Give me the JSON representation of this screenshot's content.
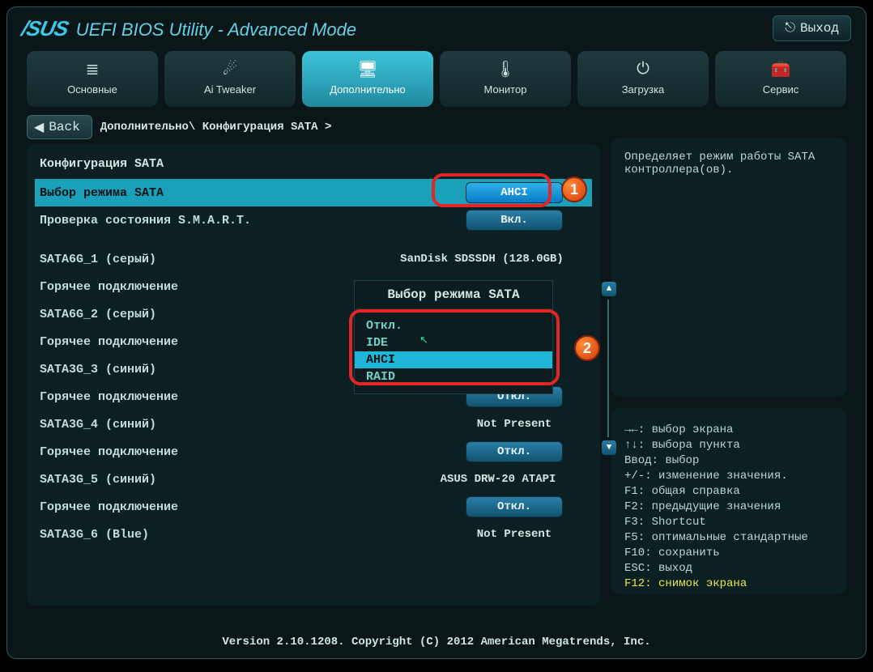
{
  "header": {
    "brand": "/SUS",
    "title": "UEFI BIOS Utility - Advanced Mode",
    "exit_label": "Выход"
  },
  "tabs": [
    {
      "label": "Основные"
    },
    {
      "label": "Ai Tweaker"
    },
    {
      "label": "Дополнительно"
    },
    {
      "label": "Монитор"
    },
    {
      "label": "Загрузка"
    },
    {
      "label": "Сервис"
    }
  ],
  "back_label": "Back",
  "breadcrumb": "Дополнительно\\ Конфигурация SATA >",
  "section_title": "Конфигурация SATA",
  "rows": {
    "sata_mode": {
      "label": "Выбор режима SATA",
      "value": "AHCI"
    },
    "smart": {
      "label": "Проверка состояния S.M.A.R.T.",
      "value": "Вкл."
    },
    "sata6g1": {
      "label": "SATA6G_1 (серый)",
      "value": "SanDisk SDSSDH (128.0GB)"
    },
    "hp1": {
      "label": "Горячее подключение",
      "value": ""
    },
    "sata6g2": {
      "label": "SATA6G_2 (серый)",
      "value": ""
    },
    "hp2": {
      "label": "Горячее подключение",
      "value": ""
    },
    "sata3g3": {
      "label": "SATA3G_3 (синий)",
      "value": ""
    },
    "hp3": {
      "label": "Горячее подключение",
      "value": "Откл."
    },
    "sata3g4": {
      "label": "SATA3G_4 (синий)",
      "value": "Not Present"
    },
    "hp4": {
      "label": "Горячее подключение",
      "value": "Откл."
    },
    "sata3g5": {
      "label": "SATA3G_5 (синий)",
      "value": "ASUS    DRW-20 ATAPI"
    },
    "hp5": {
      "label": "Горячее подключение",
      "value": "Откл."
    },
    "sata3g6": {
      "label": "SATA3G_6 (Blue)",
      "value": "Not Present"
    }
  },
  "dropdown": {
    "title": "Выбор режима SATA",
    "opt0": "Откл.",
    "opt1": "IDE",
    "opt2": "AHCI",
    "opt3": "RAID"
  },
  "badges": {
    "one": "1",
    "two": "2"
  },
  "help_text": "Определяет режим работы SATA контроллера(ов).",
  "keys": {
    "k0": "→←: выбор экрана",
    "k1": "↑↓: выбора пункта",
    "k2": "Ввод: выбор",
    "k3": "+/-: изменение значения.",
    "k4": "F1: общая справка",
    "k5": "F2: предыдущие значения",
    "k6": "F3: Shortcut",
    "k7": "F5: оптимальные стандартные",
    "k8": "F10: сохранить",
    "k9": "ESC: выход",
    "k10": "F12: снимок экрана"
  },
  "footer": "Version 2.10.1208. Copyright (C) 2012 American Megatrends, Inc."
}
